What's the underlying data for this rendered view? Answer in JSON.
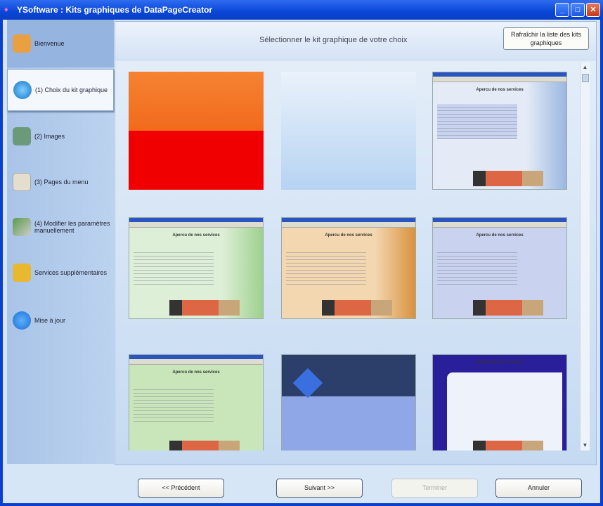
{
  "window": {
    "title": "YSoftware : Kits graphiques de DataPageCreator"
  },
  "sidebar": {
    "items": [
      {
        "label": "Bienvenue",
        "icon": "welcome-icon",
        "color": "#e9a043"
      },
      {
        "label": "(1) Choix du kit graphique",
        "icon": "globe-icon",
        "color": "#2a8fd8"
      },
      {
        "label": "(2) Images",
        "icon": "images-icon",
        "color": "#6a9a7a"
      },
      {
        "label": "(3) Pages du menu",
        "icon": "pages-icon",
        "color": "#d9d2bc"
      },
      {
        "label": "(4) Modifier les paramètres manuellement",
        "icon": "tools-icon",
        "color": "#5a9a4a"
      },
      {
        "label": "Services supplémentaires",
        "icon": "box-icon",
        "color": "#e8b830"
      },
      {
        "label": "Mise à jour",
        "icon": "update-icon",
        "color": "#1f6fd0"
      }
    ]
  },
  "panel": {
    "caption": "Sélectionner le kit graphique de votre choix",
    "refresh_label": "Rafraîchir la liste des kits graphiques"
  },
  "thumb_text": "Apercu de nos services",
  "footer": {
    "previous": "<< Précédent",
    "next": "Suivant >>",
    "finish": "Terminer",
    "cancel": "Annuler"
  }
}
